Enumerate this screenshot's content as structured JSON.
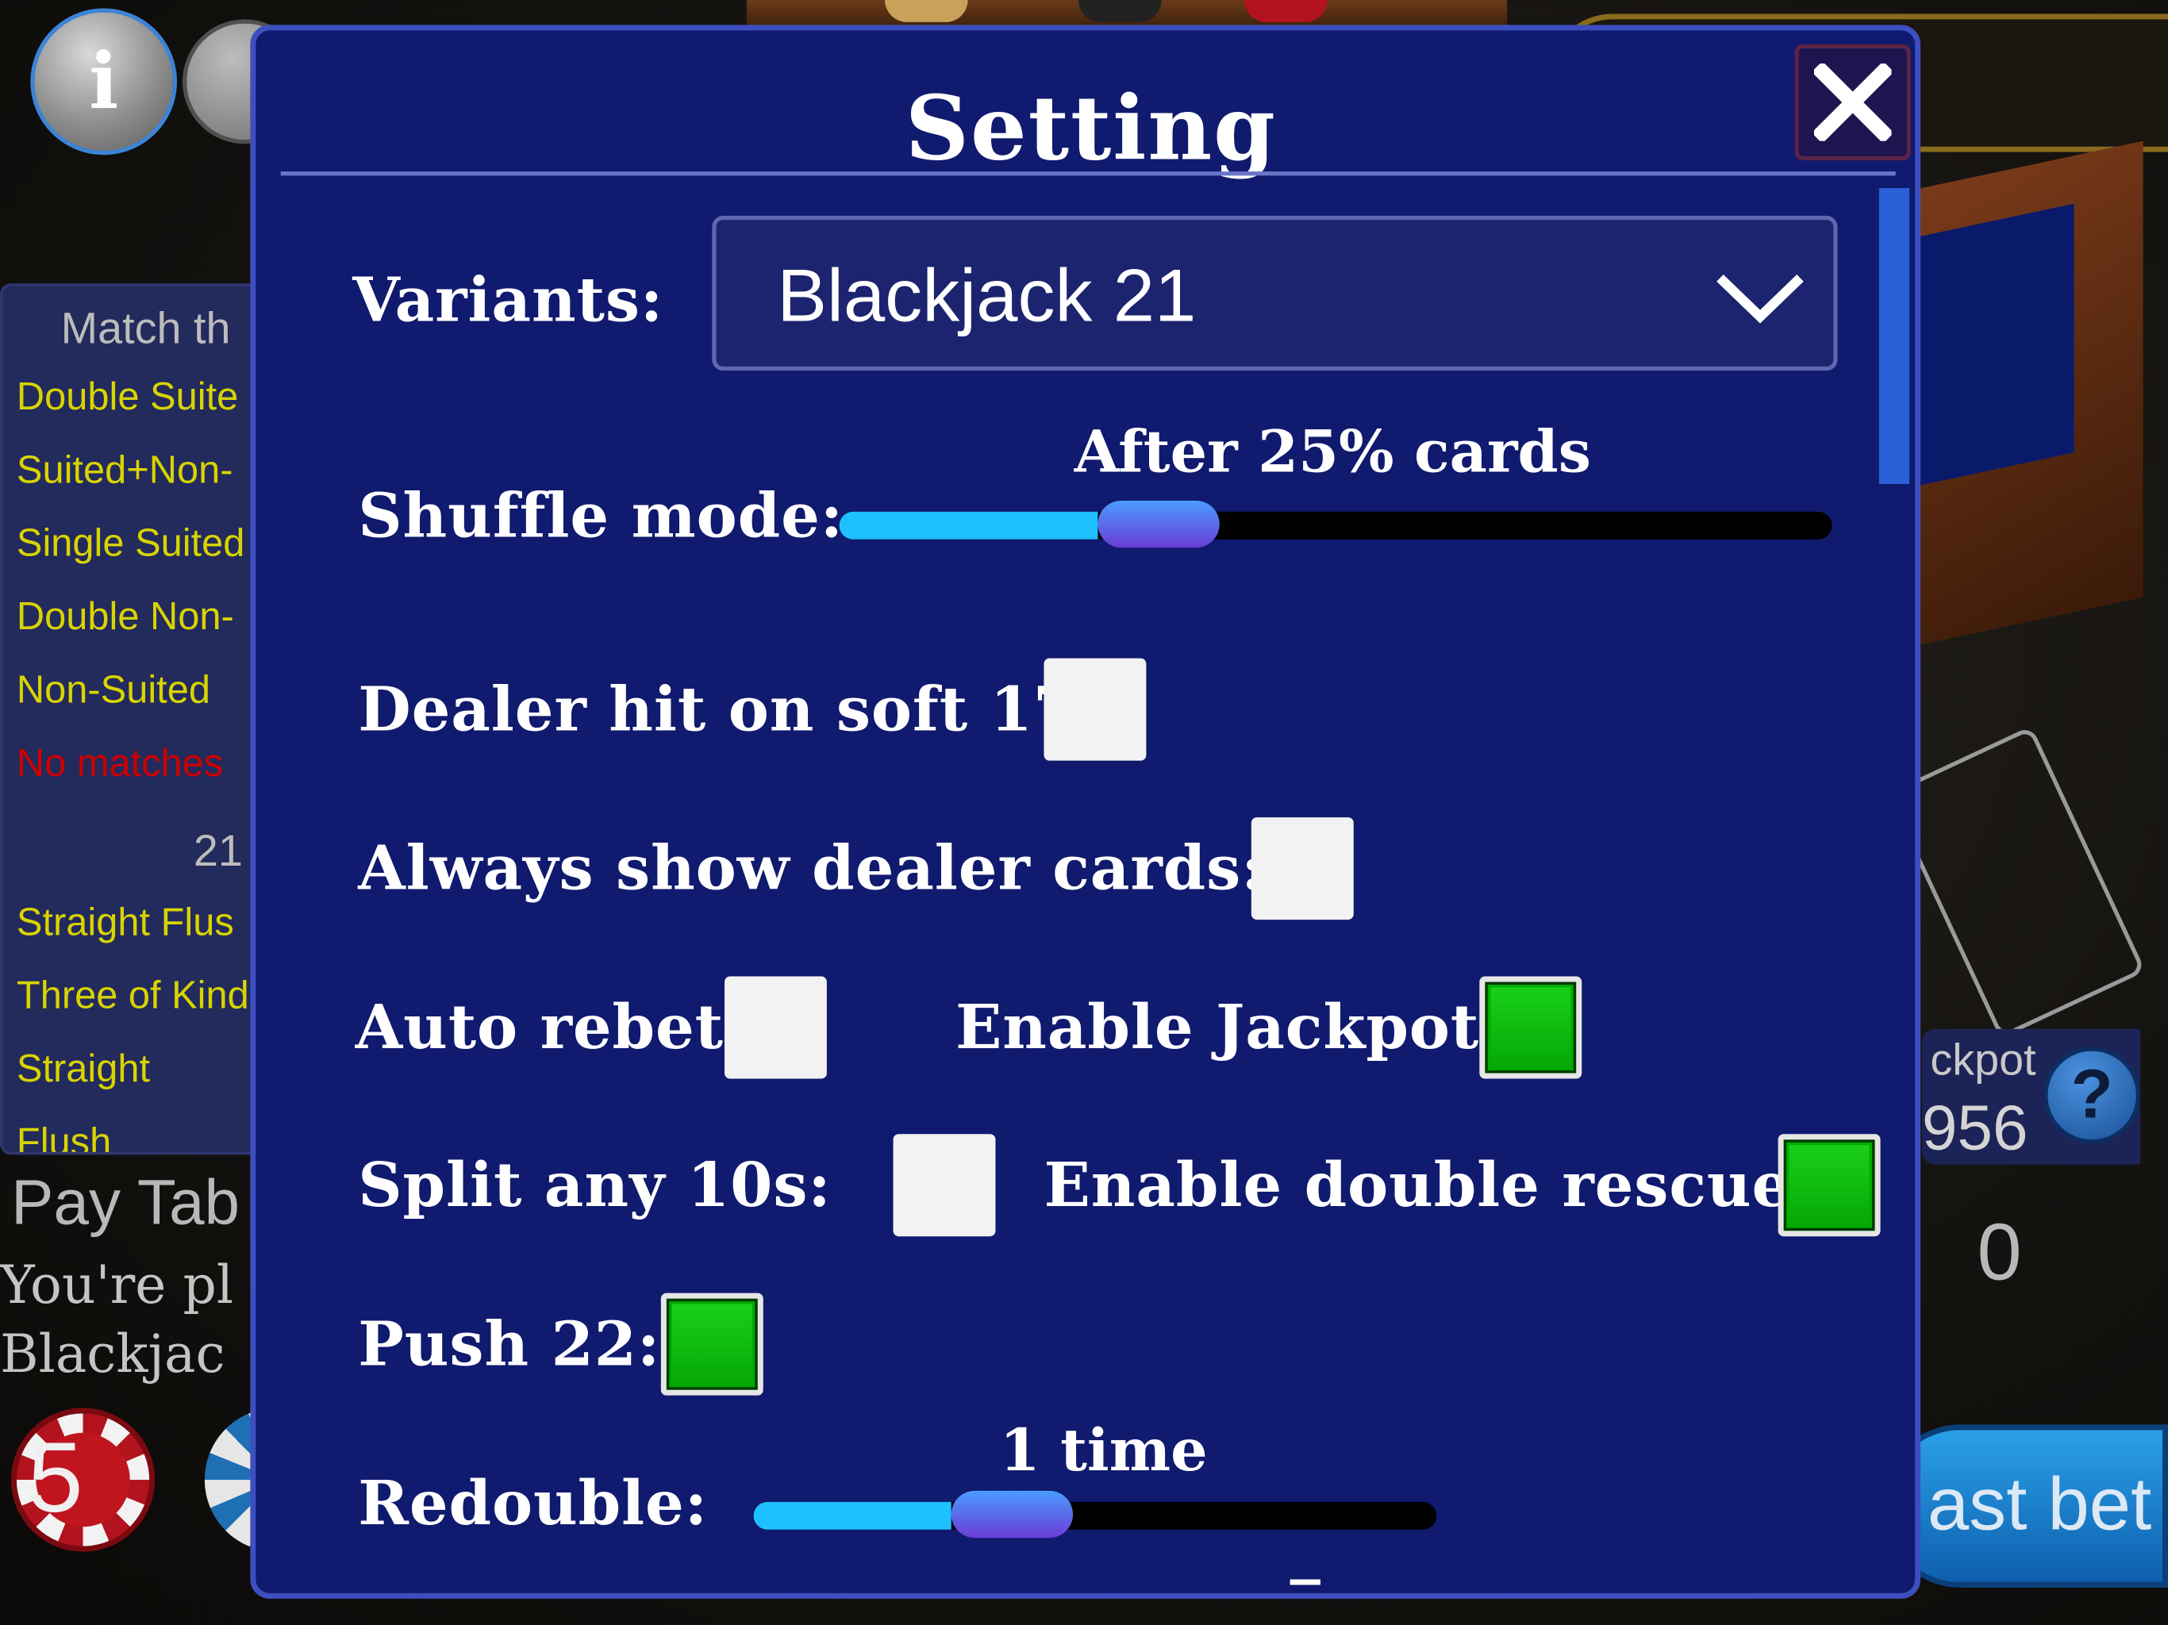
{
  "background": {
    "info_label": "i",
    "paytable": {
      "header": "Match th",
      "rows": [
        {
          "label": "Double Suite",
          "color": "#d8d400"
        },
        {
          "label": "Suited+Non-",
          "color": "#d8d400"
        },
        {
          "label": "Single Suited",
          "color": "#d8d400"
        },
        {
          "label": "Double Non-",
          "color": "#d8d400"
        },
        {
          "label": "Non-Suited",
          "color": "#d8d400"
        },
        {
          "label": "No matches",
          "color": "#cc0000"
        }
      ],
      "sub_header": "21",
      "rows2": [
        "Straight Flus",
        "Three of Kind",
        "Straight",
        "Flush"
      ],
      "title": "Pay Tab",
      "desc_line1": "You're pl",
      "desc_line2": "Blackjac"
    },
    "chip_value": "5",
    "jackpot_label": "ckpot",
    "jackpot_value": "956",
    "jackpot_help": "?",
    "bet_count": "0",
    "last_bet_label": "ast bet"
  },
  "dialog": {
    "title": "Setting",
    "close_icon": "close-icon",
    "variants": {
      "label": "Variants:",
      "selected": "Blackjack 21"
    },
    "shuffle_mode": {
      "label": "Shuffle mode:",
      "value_text": "After 25% cards",
      "level": 0.26
    },
    "options": {
      "dealer_hit_soft17": {
        "label": "Dealer hit on soft 17:",
        "checked": false
      },
      "always_show_dealer": {
        "label": "Always show dealer cards:",
        "checked": false
      },
      "auto_rebet": {
        "label": "Auto rebet:",
        "checked": false
      },
      "enable_jackpot": {
        "label": "Enable Jackpot:",
        "checked": true
      },
      "split_any_10s": {
        "label": "Split any 10s:",
        "checked": false
      },
      "enable_double_rescue": {
        "label": "Enable double rescue:",
        "checked": true
      },
      "push_22": {
        "label": "Push 22:",
        "checked": true
      }
    },
    "redouble": {
      "label": "Redouble:",
      "value_text": "1 time",
      "level": 0.29
    },
    "colors": {
      "background": "#101a6e",
      "checked": "#0a0",
      "slider_fill": "#1ec0ff"
    }
  }
}
